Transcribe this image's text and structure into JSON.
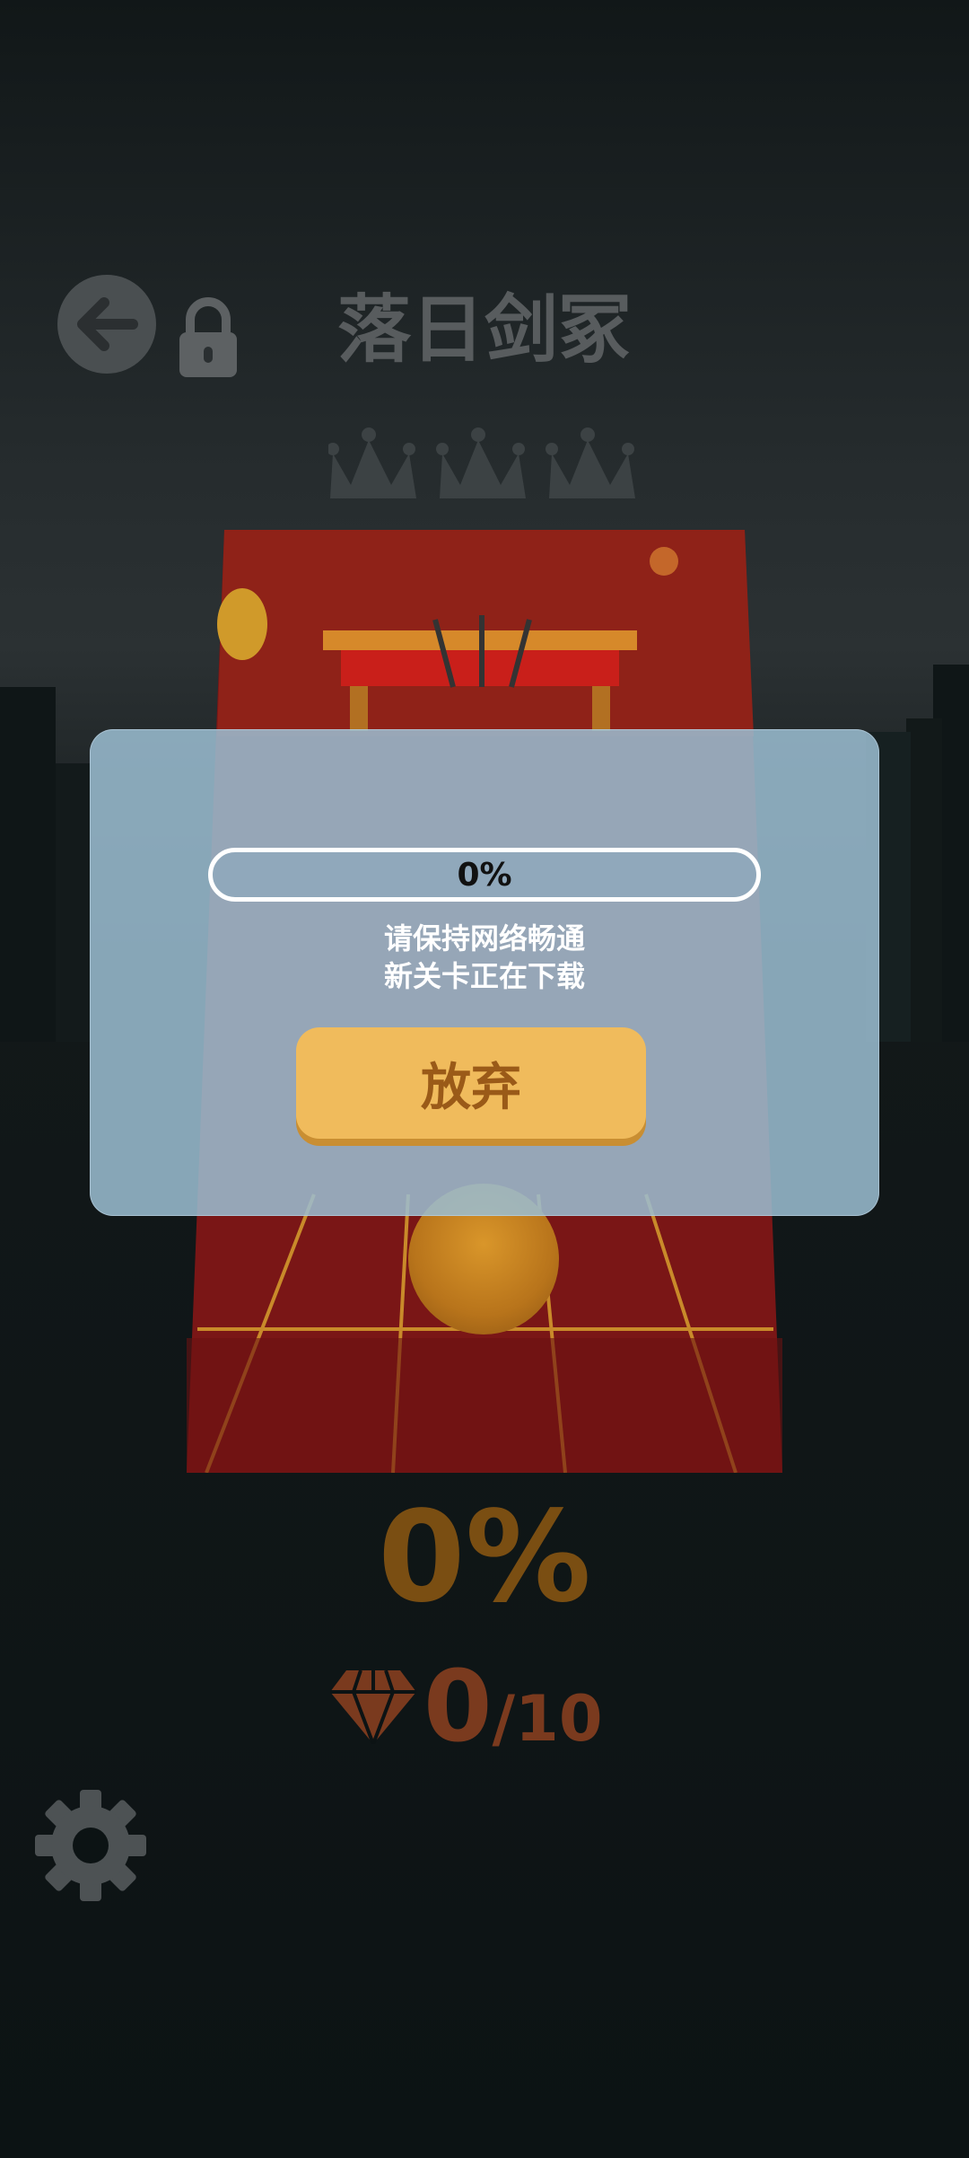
{
  "level": {
    "title": "落日剑冢",
    "crowns_earned": 0,
    "crowns_total": 3
  },
  "dialog": {
    "progress_fraction": 0,
    "progress_text": "0%",
    "message_line1": "请保持网络畅通",
    "message_line2": "新关卡正在下载",
    "give_up_label": "放弃"
  },
  "stats": {
    "percent": "0%",
    "gems_collected": "0",
    "gems_total": "/10"
  },
  "icons": {
    "back": "arrow-left-icon",
    "lock": "lock-icon",
    "crown": "crown-icon",
    "gem": "diamond-icon",
    "settings": "gear-icon"
  },
  "colors": {
    "accent": "#f0bb5c",
    "percent": "#7a4e12",
    "gem": "#7a3a1e"
  }
}
